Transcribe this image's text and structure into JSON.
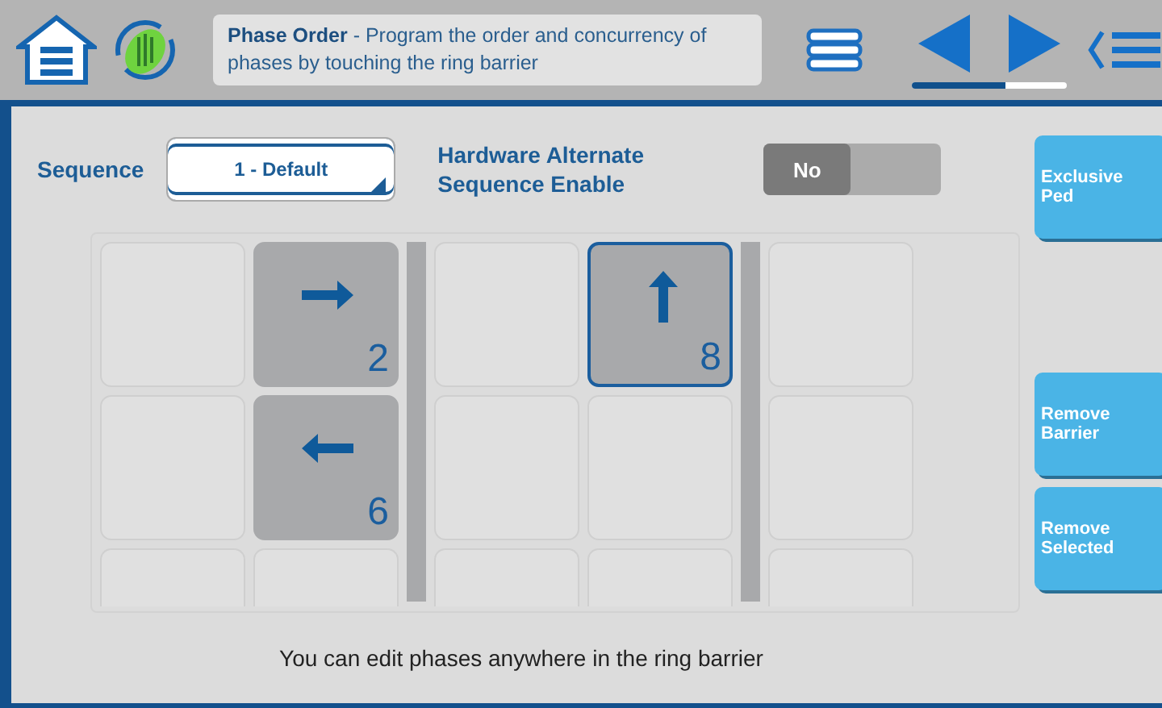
{
  "header": {
    "title": "Phase Order",
    "description": " - Program the order and concurrency of phases by touching the ring barrier"
  },
  "sequence": {
    "label": "Sequence",
    "value": "1 - Default"
  },
  "hardware_alternate": {
    "label": "Hardware Alternate Sequence Enable",
    "value": "No",
    "on": false
  },
  "grid": {
    "columns": [
      {
        "kind": "phases",
        "cells": [
          {
            "kind": "empty"
          },
          {
            "kind": "empty"
          },
          {
            "kind": "empty"
          }
        ]
      },
      {
        "kind": "phases",
        "cells": [
          {
            "kind": "east",
            "number": "2",
            "selected": false
          },
          {
            "kind": "west",
            "number": "6",
            "selected": false
          },
          {
            "kind": "empty"
          }
        ]
      },
      {
        "kind": "barrier"
      },
      {
        "kind": "phases",
        "cells": [
          {
            "kind": "empty"
          },
          {
            "kind": "empty"
          },
          {
            "kind": "empty"
          }
        ]
      },
      {
        "kind": "phases",
        "cells": [
          {
            "kind": "north",
            "number": "8",
            "selected": true
          },
          {
            "kind": "empty"
          },
          {
            "kind": "empty"
          }
        ]
      },
      {
        "kind": "barrier"
      },
      {
        "kind": "phases",
        "cells": [
          {
            "kind": "empty"
          },
          {
            "kind": "empty"
          },
          {
            "kind": "empty"
          }
        ]
      }
    ]
  },
  "buttons": [
    "Exclusive Ped",
    "Remove Barrier",
    "Remove Selected"
  ],
  "hint": "You can edit phases anywhere in the ring barrier"
}
